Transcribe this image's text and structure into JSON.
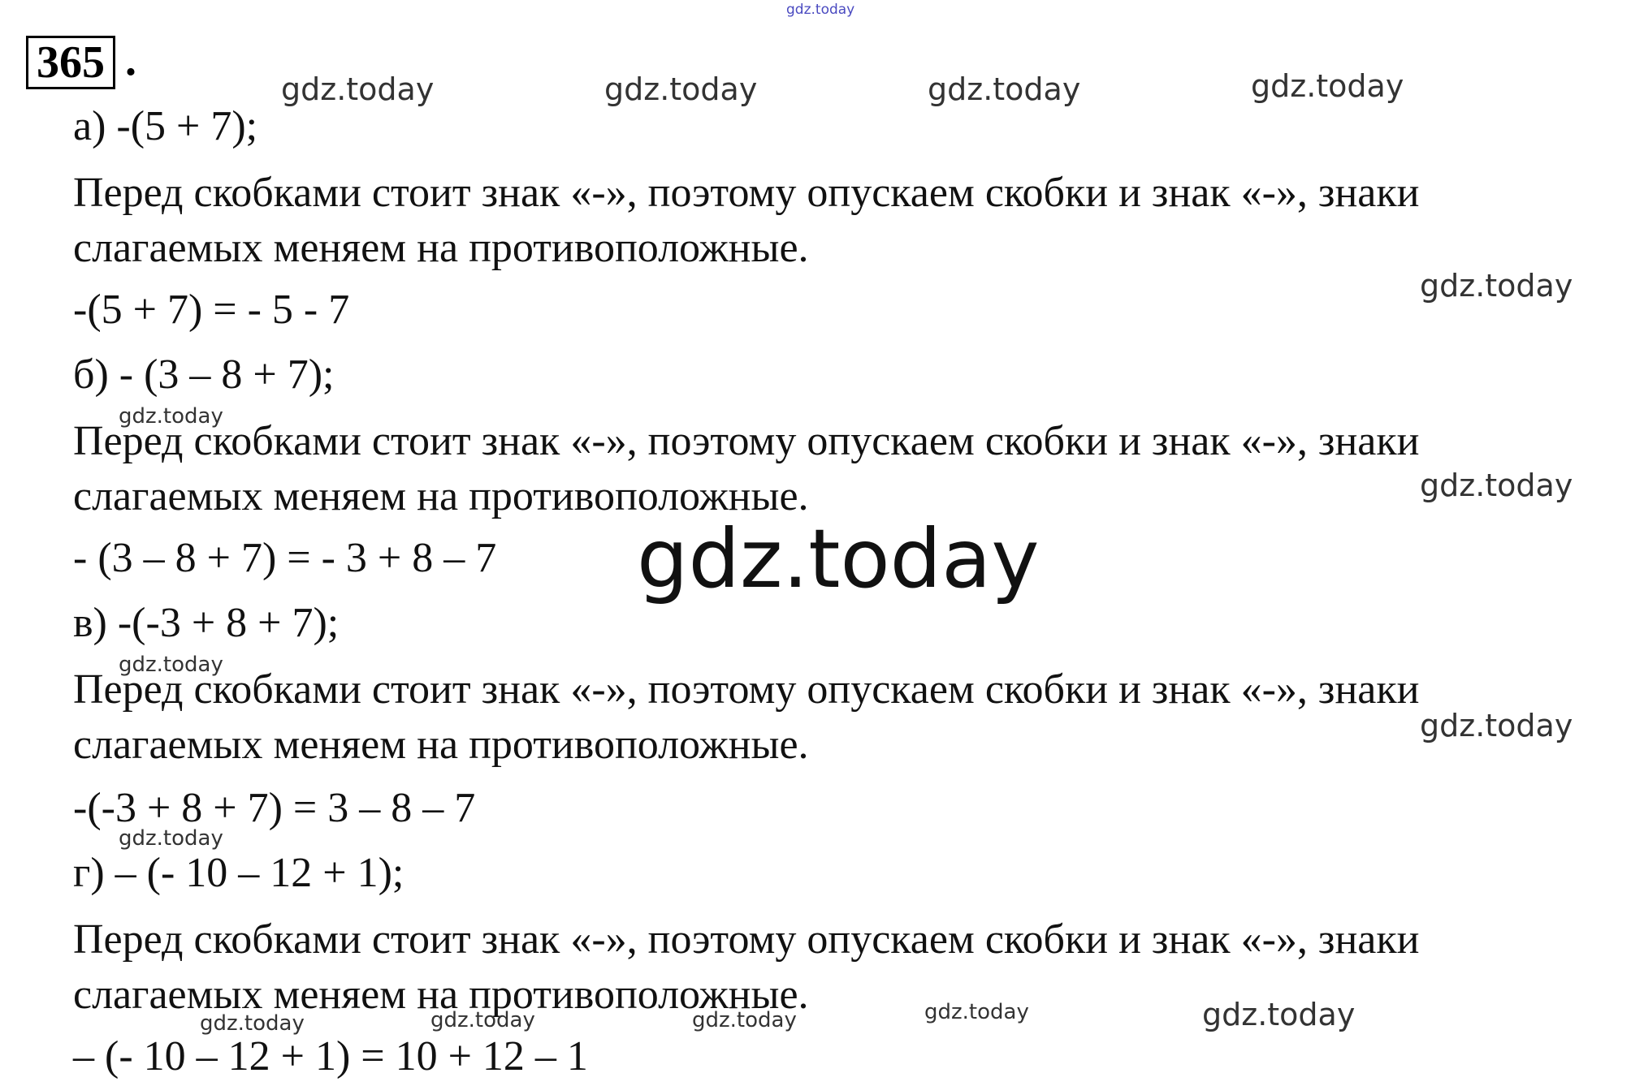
{
  "problem_number": "365",
  "dot": ".",
  "parts": [
    {
      "label_expr": "а) -(5 + 7);",
      "text_line1": "Перед скобками стоит знак «-», поэтому опускаем скобки и знак «-», знаки",
      "text_line2": "слагаемых меняем на противоположные.",
      "result": "-(5 + 7) = - 5 - 7"
    },
    {
      "label_expr": "б)  - (3 – 8 + 7);",
      "text_line1": "Перед скобками стоит знак «-», поэтому опускаем скобки и знак «-», знаки",
      "text_line2": "слагаемых меняем на противоположные.",
      "result": "- (3 – 8 + 7) = - 3 + 8 – 7"
    },
    {
      "label_expr": "в) -(-3 + 8 + 7);",
      "text_line1": "Перед скобками стоит знак «-», поэтому опускаем скобки и знак «-», знаки",
      "text_line2": "слагаемых меняем на противоположные.",
      "result": "-(-3 + 8 + 7) = 3 – 8 – 7"
    },
    {
      "label_expr": "г) – (- 10 – 12 + 1);",
      "text_line1": "Перед скобками стоит знак «-», поэтому опускаем скобки и знак «-», знаки",
      "text_line2": "слагаемых меняем на противоположные.",
      "result": "– (- 10 – 12 + 1) = 10 + 12 – 1"
    }
  ],
  "watermark": "gdz.today"
}
